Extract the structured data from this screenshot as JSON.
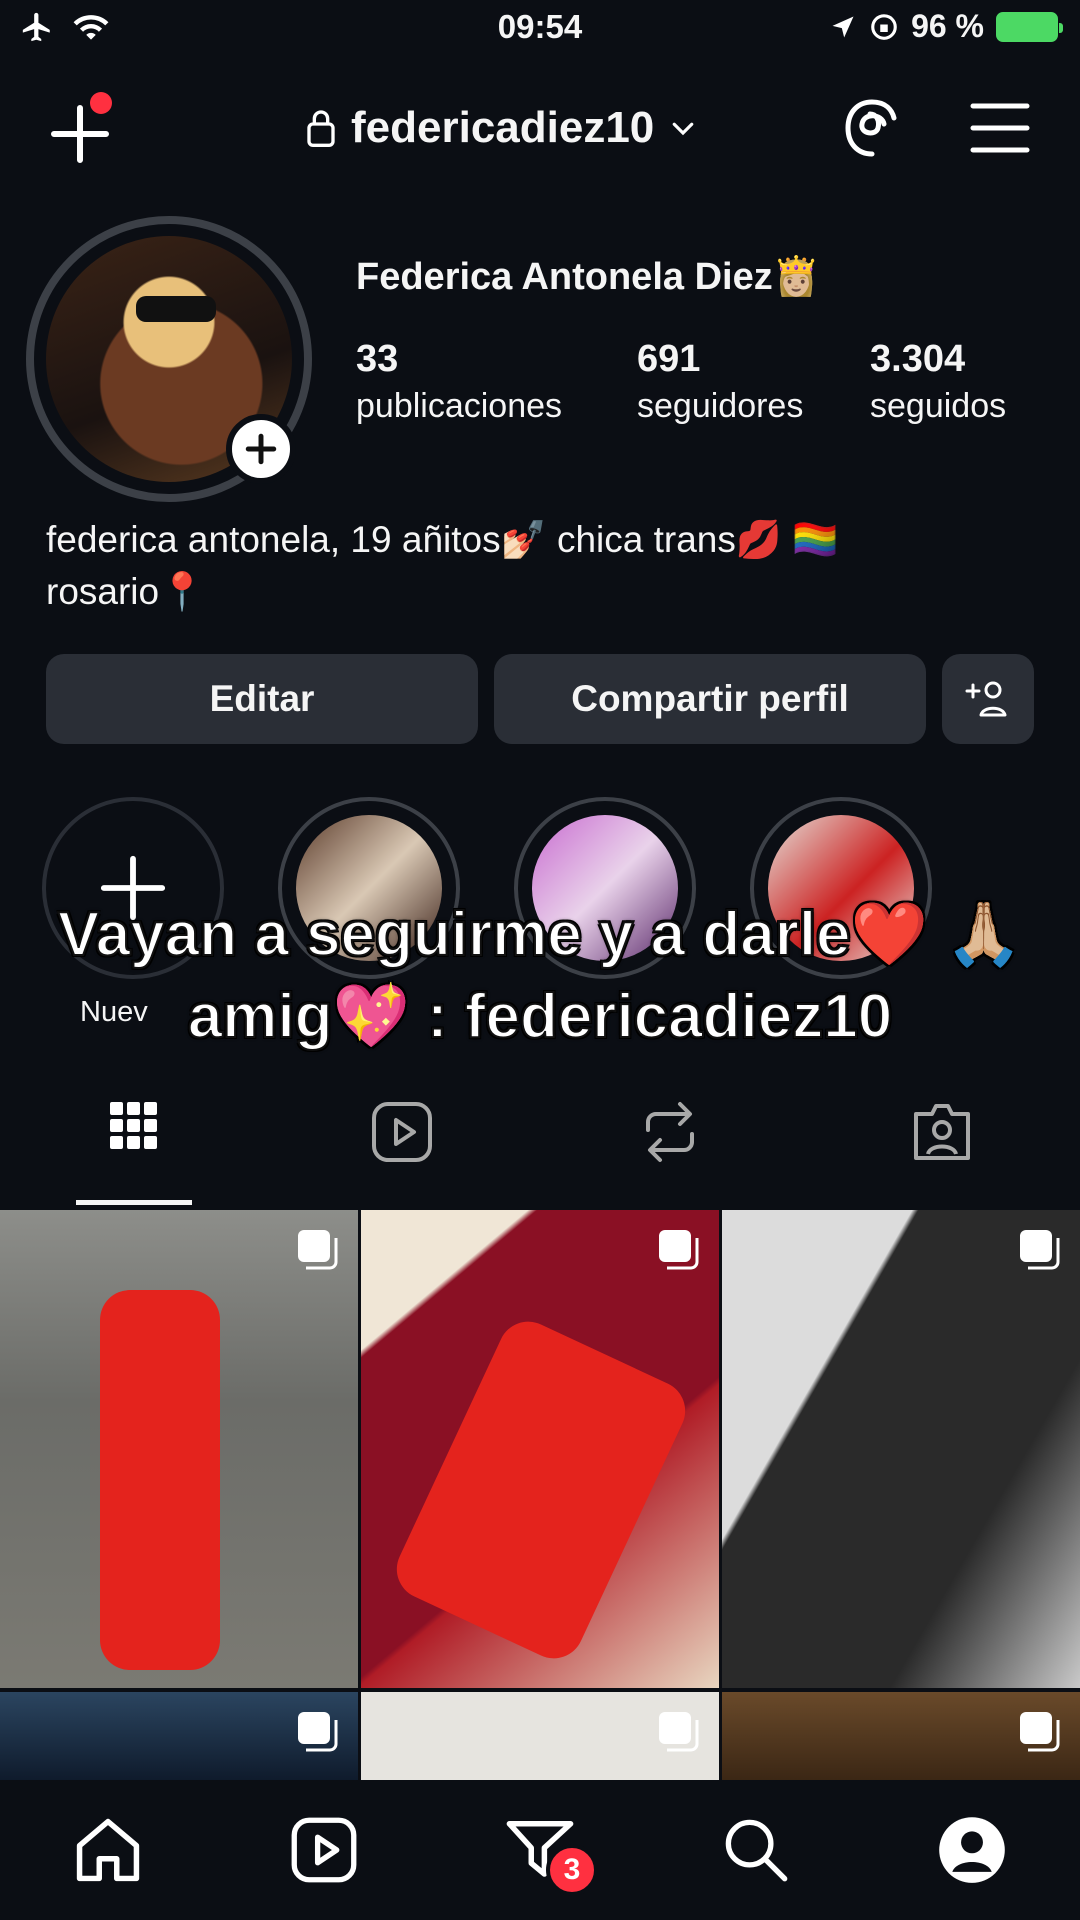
{
  "status_bar": {
    "time": "09:54",
    "battery": "96 %",
    "icons": [
      "airplane-icon",
      "wifi-icon",
      "location-icon",
      "lock-rotation-icon",
      "battery-charging-icon"
    ]
  },
  "header": {
    "username": "federicadiez10",
    "icons": [
      "create-plus-icon",
      "lock-icon",
      "chevron-down-icon",
      "threads-icon",
      "menu-icon"
    ]
  },
  "profile": {
    "display_name": "Federica Antonela Diez👸🏼",
    "stats": {
      "posts_count": "33",
      "posts_label": "publicaciones",
      "followers_count": "691",
      "followers_label": "seguidores",
      "following_count": "3.304",
      "following_label": "seguidos"
    },
    "bio_line1": "federica antonela, 19 añitos💅🏻 chica trans💋 🏳️‍🌈",
    "bio_line2": "rosario📍"
  },
  "actions": {
    "edit_label": "Editar",
    "share_label": "Compartir perfil"
  },
  "highlights": {
    "new_label": "Nuev"
  },
  "overlay": {
    "line1": "Vayan a seguirme y a darle❤️ 🙏🏼",
    "line2": "amig💖 : federicadiez10"
  },
  "tabs": [
    "grid-icon",
    "reels-icon",
    "reposts-icon",
    "tagged-icon"
  ],
  "bottom_nav": {
    "activity_badge": "3",
    "items": [
      "home-icon",
      "reels-icon",
      "activity-icon",
      "search-icon",
      "profile-icon"
    ]
  },
  "colors": {
    "background": "#0b0e14",
    "button": "#2a2e36",
    "badge": "#ff3040",
    "battery": "#4cd964"
  }
}
